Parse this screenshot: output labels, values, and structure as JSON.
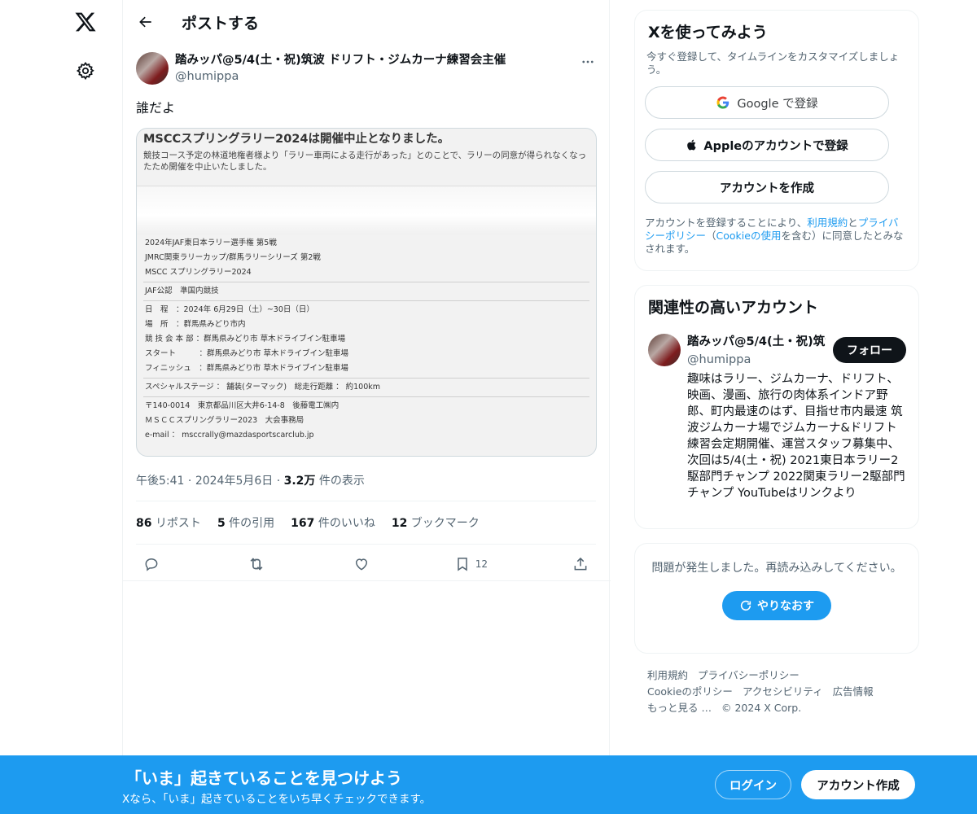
{
  "header": {
    "title": "ポストする"
  },
  "post": {
    "author_name": "踏みッパ@5/4(土・祝)筑波 ドリフト・ジムカーナ練習会主催",
    "author_handle": "@humippa",
    "text": "誰だよ",
    "media": {
      "notice_title": "MSCCスプリングラリー2024は開催中止となりました。",
      "notice_body": "競技コース予定の林道地権者様より「ラリー車両による走行があった」とのことで、ラリーの同意が得られなくなったため開催を中止いたしました。",
      "doc_lines": [
        "2024年JAF東日本ラリー選手権 第5戦",
        "JMRC関東ラリーカップ/群馬ラリーシリーズ 第2戦",
        "MSCC スプリングラリー2024",
        "JAF公認　準国内競技",
        "日　程　：2024年 6月29日（土）~30日（日）",
        "場　所　：群馬県みどり市内",
        "競 技 会 本 部 ：群馬県みどり市 草木ドライブイン駐車場",
        "スタート　　　：群馬県みどり市 草木ドライブイン駐車場",
        "フィニッシュ　：群馬県みどり市 草木ドライブイン駐車場",
        "スペシャルステージ ： 舗装(ターマック)　総走行距離 ： 約100km",
        "〒140-0014　東京都品川区大井6-14-8　後藤電工㈱内",
        "ＭＳＣＣスプリングラリー2023　大会事務局",
        "e-mail ：  msccrally@mazdasportscarclub.jp"
      ]
    },
    "time": "午後5:41",
    "date": "2024年5月6日",
    "views_count": "3.2万",
    "views_label": "件の表示",
    "stats": {
      "reposts_count": "86",
      "reposts_label": "リポスト",
      "quotes_count": "5",
      "quotes_label": "件の引用",
      "likes_count": "167",
      "likes_label": "件のいいね",
      "bookmarks_count": "12",
      "bookmarks_label": "ブックマーク"
    },
    "bookmark_action_count": "12"
  },
  "signup": {
    "title": "Xを使ってみよう",
    "subtitle": "今すぐ登録して、タイムラインをカスタマイズしましょう。",
    "google_label": "Google で登録",
    "apple_label": "Appleのアカウントで登録",
    "create_label": "アカウントを作成",
    "terms_prefix": "アカウントを登録することにより、",
    "terms_link": "利用規約",
    "terms_and": "と",
    "privacy_link": "プライバシーポリシー",
    "terms_mid": "（",
    "cookie_link": "Cookieの使用",
    "terms_suffix": "を含む）に同意したとみなされます。"
  },
  "related": {
    "title": "関連性の高いアカウント",
    "name": "踏みッパ@5/4(土・祝)筑波",
    "handle": "@humippa",
    "follow_label": "フォロー",
    "bio": "趣味はラリー、ジムカーナ、ドリフト、映画、漫画、旅行の肉体系インドア野郎、町内最速のはず、目指せ市内最速 筑波ジムカーナ場でジムカーナ&ドリフト練習会定期開催、運営スタッフ募集中、次回は5/4(土・祝) 2021東日本ラリー2駆部門チャンプ 2022関東ラリー2駆部門チャンプ YouTubeはリンクより"
  },
  "error": {
    "message": "問題が発生しました。再読み込みしてください。",
    "retry_label": "やりなおす"
  },
  "footer": {
    "links": [
      "利用規約",
      "プライバシーポリシー",
      "Cookieのポリシー",
      "アクセシビリティ",
      "広告情報",
      "もっと見る …",
      "© 2024 X Corp."
    ]
  },
  "banner": {
    "title": "「いま」起きていることを見つけよう",
    "subtitle": "Xなら、「いま」起きていることをいち早くチェックできます。",
    "login_label": "ログイン",
    "create_label": "アカウント作成"
  }
}
